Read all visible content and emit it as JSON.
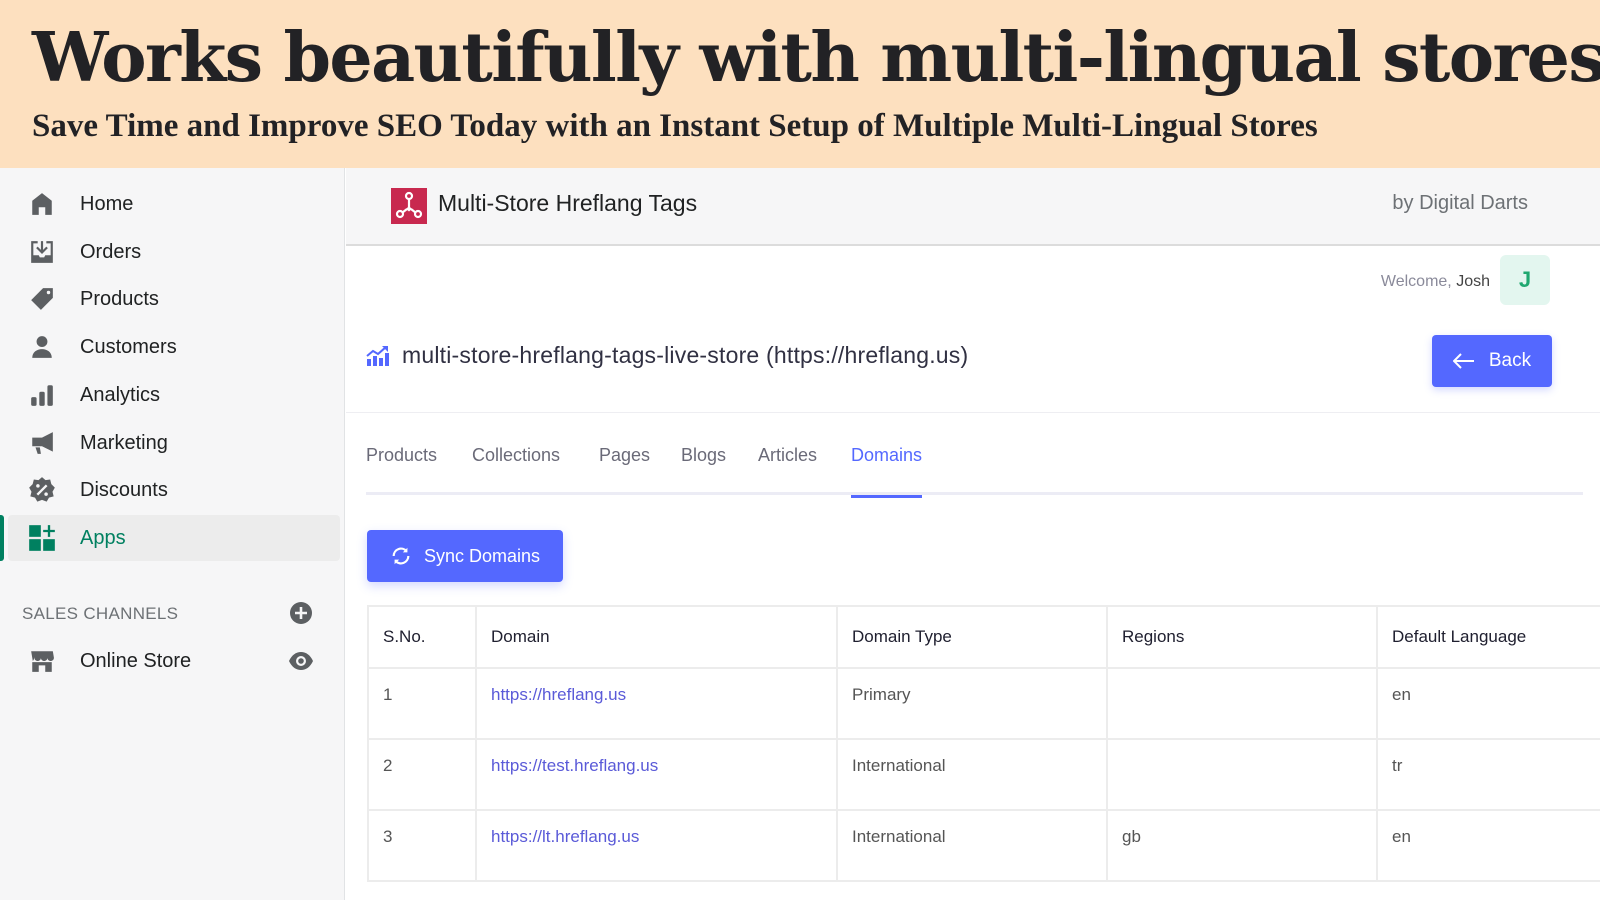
{
  "banner": {
    "headline": "Works beautifully with multi-lingual stores",
    "subheadline": "Save Time and Improve SEO Today with an Instant Setup of Multiple Multi-Lingual Stores"
  },
  "sidebar": {
    "items": [
      {
        "label": "Home",
        "icon": "home-icon"
      },
      {
        "label": "Orders",
        "icon": "orders-icon"
      },
      {
        "label": "Products",
        "icon": "tag-icon"
      },
      {
        "label": "Customers",
        "icon": "person-icon"
      },
      {
        "label": "Analytics",
        "icon": "bar-chart-icon"
      },
      {
        "label": "Marketing",
        "icon": "megaphone-icon"
      },
      {
        "label": "Discounts",
        "icon": "discount-badge-icon"
      },
      {
        "label": "Apps",
        "icon": "apps-grid-icon",
        "active": true
      }
    ],
    "sales_channels_title": "SALES CHANNELS",
    "channels": [
      {
        "label": "Online Store",
        "icon": "store-icon"
      }
    ]
  },
  "app_header": {
    "title": "Multi-Store Hreflang Tags",
    "by": "by Digital Darts",
    "logo_color": "#c8294f"
  },
  "user": {
    "welcome": "Welcome,",
    "name": "Josh",
    "initial": "J"
  },
  "store": {
    "title": "multi-store-hreflang-tags-live-store (https://hreflang.us)",
    "back_label": "Back"
  },
  "tabs": [
    {
      "label": "Products"
    },
    {
      "label": "Collections"
    },
    {
      "label": "Pages"
    },
    {
      "label": "Blogs"
    },
    {
      "label": "Articles"
    },
    {
      "label": "Domains",
      "active": true
    }
  ],
  "sync_label": "Sync Domains",
  "table": {
    "headers": [
      "S.No.",
      "Domain",
      "Domain Type",
      "Regions",
      "Default Language"
    ],
    "rows": [
      {
        "sno": "1",
        "domain": "https://hreflang.us",
        "type": "Primary",
        "regions": "",
        "lang": "en"
      },
      {
        "sno": "2",
        "domain": "https://test.hreflang.us",
        "type": "International",
        "regions": "",
        "lang": "tr"
      },
      {
        "sno": "3",
        "domain": "https://lt.hreflang.us",
        "type": "International",
        "regions": "gb",
        "lang": "en"
      }
    ]
  },
  "colors": {
    "accent": "#5468ff",
    "active_nav": "#008060",
    "banner_bg": "#fde0bf"
  }
}
